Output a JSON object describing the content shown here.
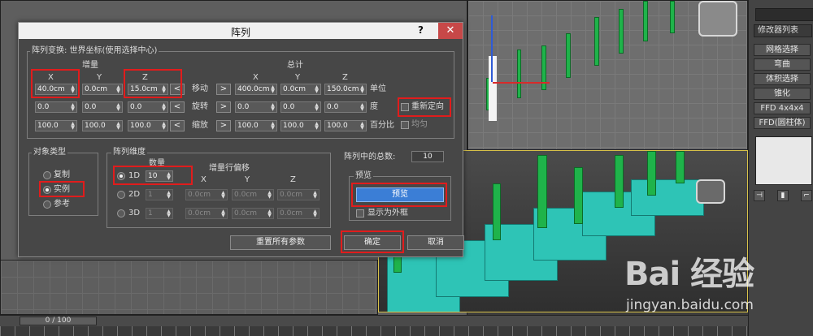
{
  "dialog": {
    "title": "阵列",
    "help": "?",
    "close": "✕",
    "transform": {
      "legend": "阵列变换: 世界坐标(使用选择中心)",
      "increment_label": "增量",
      "total_label": "总计",
      "axis": [
        "X",
        "Y",
        "Z"
      ],
      "rows": [
        {
          "label": "移动",
          "unit": "单位",
          "inc": [
            "40.0cm",
            "0.0cm",
            "15.0cm"
          ],
          "tot": [
            "400.0cm",
            "0.0cm",
            "150.0cm"
          ]
        },
        {
          "label": "旋转",
          "unit": "度",
          "inc": [
            "0.0",
            "0.0",
            "0.0"
          ],
          "tot": [
            "0.0",
            "0.0",
            "0.0"
          ]
        },
        {
          "label": "缩放",
          "unit": "百分比",
          "inc": [
            "100.0",
            "100.0",
            "100.0"
          ],
          "tot": [
            "100.0",
            "100.0",
            "100.0"
          ]
        }
      ],
      "arrow_left": "<",
      "arrow_right": ">",
      "reorient": "重新定向",
      "uniform": "均匀"
    },
    "object_type": {
      "legend": "对象类型",
      "options": [
        "复制",
        "实例",
        "参考"
      ],
      "selected": "实例"
    },
    "dimensions": {
      "legend": "阵列维度",
      "count_label": "数量",
      "offset_label": "增量行偏移",
      "axis": [
        "X",
        "Y",
        "Z"
      ],
      "rows": [
        {
          "label": "1D",
          "count": "10"
        },
        {
          "label": "2D",
          "count": "1",
          "offsets": [
            "0.0cm",
            "0.0cm",
            "0.0cm"
          ]
        },
        {
          "label": "3D",
          "count": "1",
          "offsets": [
            "0.0cm",
            "0.0cm",
            "0.0cm"
          ]
        }
      ]
    },
    "total_label": "阵列中的总数:",
    "total_value": "10",
    "preview": {
      "legend": "预览",
      "button": "预览",
      "show_box": "显示为外框"
    },
    "reset": "重置所有参数",
    "ok": "确定",
    "cancel": "取消"
  },
  "command_panel": {
    "modifier_list": "修改器列表",
    "buttons": [
      "网格选择",
      "弯曲",
      "体积选择",
      "锥化",
      "FFD 4x4x4",
      "FFD(圆柱体)"
    ]
  },
  "timeline": {
    "frame": "0 / 100"
  },
  "watermark": {
    "logo": "Bai 经验",
    "url": "jingyan.baidu.com"
  },
  "colors": {
    "highlight": "#e11c1c",
    "preview_button": "#3b7ed6",
    "pillar": "#1fb34a",
    "step": "#2ec4b6"
  }
}
